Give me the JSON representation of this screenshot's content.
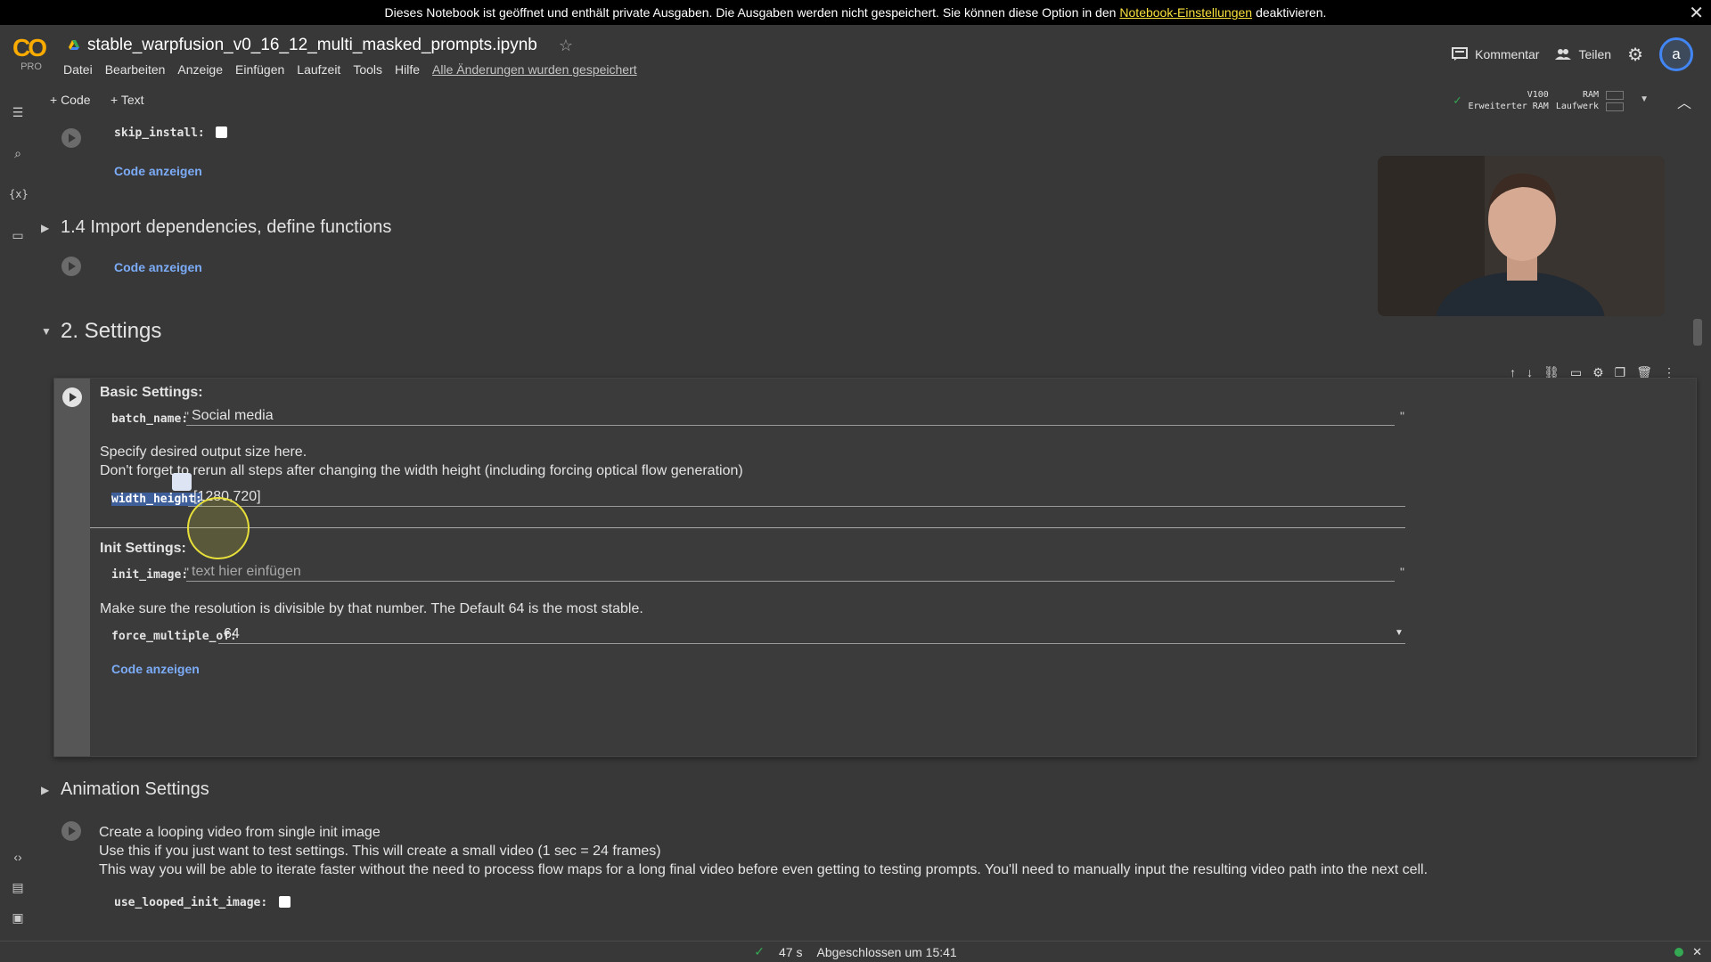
{
  "banner": {
    "text_before": "Dieses Notebook ist geöffnet und enthält private Ausgaben. Die Ausgaben werden nicht gespeichert. Sie können diese Option in den",
    "link": "Notebook-Einstellungen",
    "text_after": "deaktivieren.",
    "close": "✕"
  },
  "header": {
    "logo": "CO",
    "plan": "PRO",
    "title": "stable_warpfusion_v0_16_12_multi_masked_prompts.ipynb",
    "menu": [
      "Datei",
      "Bearbeiten",
      "Anzeige",
      "Einfügen",
      "Laufzeit",
      "Tools",
      "Hilfe"
    ],
    "saved_status": "Alle Änderungen wurden gespeichert",
    "comment_label": "Kommentar",
    "share_label": "Teilen",
    "avatar_letter": "a"
  },
  "toolbar": {
    "add_code": "+ Code",
    "add_text": "+ Text",
    "gpu": "V100",
    "ram_mode": "Erweiterter RAM",
    "ram_label": "RAM",
    "disk_label": "Laufwerk"
  },
  "content": {
    "skip_install_label": "skip_install:",
    "show_code_1": "Code anzeigen",
    "section_14": "1.4 Import dependencies, define functions",
    "show_code_2": "Code anzeigen",
    "section_2": "2. Settings",
    "basic_settings": "Basic Settings:",
    "batch_name_label": "batch_name:",
    "batch_name_value": "Social media",
    "output_size_line1": "Specify desired output size here.",
    "output_size_line2": "Don't forget to rerun all steps after changing the width height (including forcing optical flow generation)",
    "width_height_label": "width_height:",
    "width_height_value": "[1280,720]",
    "init_settings": "Init Settings:",
    "init_image_label": "init_image:",
    "init_image_placeholder": "text hier einfügen",
    "resolution_note": "Make sure the resolution is divisible by that number. The Default 64 is the most stable.",
    "force_multiple_label": "force_multiple_of:",
    "force_multiple_value": "64",
    "show_code_3": "Code anzeigen",
    "animation_settings": "Animation Settings",
    "loop_line1": "Create a looping video from single init image",
    "loop_line2": "Use this if you just want to test settings. This will create a small video (1 sec = 24 frames)",
    "loop_line3": "This way you will be able to iterate faster without the need to process flow maps for a long final video before even getting to testing prompts. You'll need to manually input the resulting video path into the next cell.",
    "use_looped_label": "use_looped_init_image:"
  },
  "statusbar": {
    "duration": "47 s",
    "completed": "Abgeschlossen um 15:41"
  },
  "colors": {
    "background": "#383838",
    "link": "#7cacf8",
    "banner_link": "#f9e13c",
    "logo": "#f9ab00",
    "highlight": "#3e5f9a"
  }
}
